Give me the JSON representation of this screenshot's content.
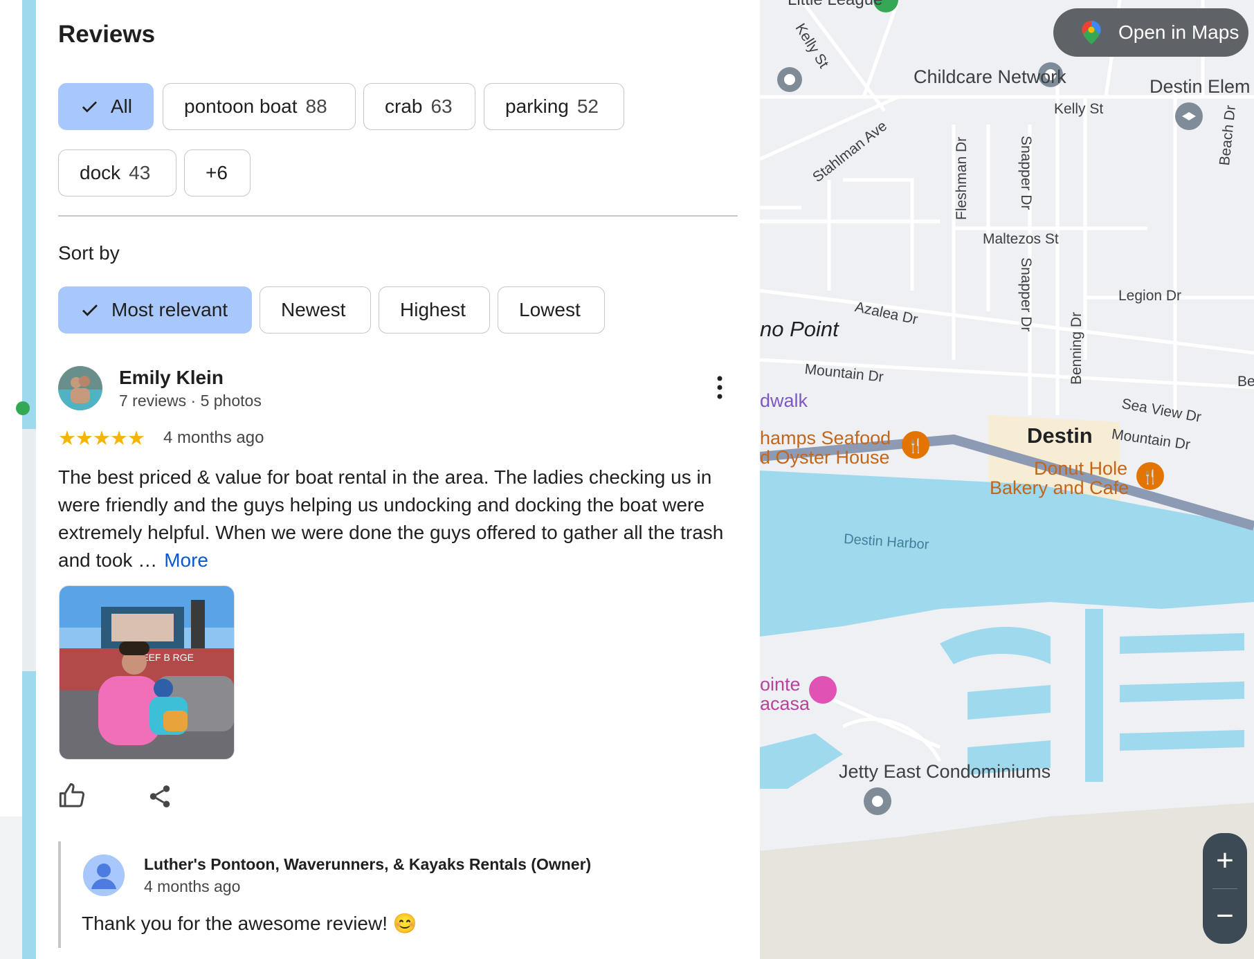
{
  "panel": {
    "title": "Reviews",
    "topic_chips": [
      {
        "label": "All",
        "count": "",
        "selected": true
      },
      {
        "label": "pontoon boat",
        "count": "88",
        "selected": false
      },
      {
        "label": "crab",
        "count": "63",
        "selected": false
      },
      {
        "label": "parking",
        "count": "52",
        "selected": false
      },
      {
        "label": "dock",
        "count": "43",
        "selected": false
      },
      {
        "label": "+6",
        "count": "",
        "selected": false
      }
    ],
    "sort_label": "Sort by",
    "sort_chips": [
      {
        "label": "Most relevant",
        "selected": true
      },
      {
        "label": "Newest",
        "selected": false
      },
      {
        "label": "Highest",
        "selected": false
      },
      {
        "label": "Lowest",
        "selected": false
      }
    ]
  },
  "review": {
    "author": "Emily Klein",
    "meta": "7 reviews · 5 photos",
    "stars": "★★★★★",
    "rating": 5,
    "date": "4 months ago",
    "text": "The best priced & value for boat rental in the area. The ladies checking us in were friendly and the guys helping us undocking and docking the boat were extremely helpful. When we were done the guys offered to gather all the trash and took …",
    "more_label": "More",
    "photo_sign": "BEEF B RGE"
  },
  "owner_reply": {
    "name": "Luther's Pontoon, Waverunners, & Kayaks Rentals (Owner)",
    "date": "4 months ago",
    "text": "Thank you for the awesome review! 😊"
  },
  "map": {
    "open_label": "Open in Maps",
    "zoom_in": "+",
    "zoom_out": "−",
    "labels": {
      "league": "Little League",
      "kelly1": "Kelly St",
      "childcare": "Childcare Network",
      "destin_elem": "Destin Elem",
      "kelly2": "Kelly St",
      "stahlman": "Stahlman Ave",
      "fleshman": "Fleshman Dr",
      "snapper1": "Snapper Dr",
      "beach": "Beach Dr",
      "maltezos": "Maltezos St",
      "snapper2": "Snapper Dr",
      "legion": "Legion Dr",
      "azalea": "Azalea Dr",
      "benning": "Benning Dr",
      "point": "no Point",
      "mountain1": "Mountain Dr",
      "be": "Be",
      "sea_view": "Sea View Dr",
      "boardwalk": "dwalk",
      "destin": "Destin",
      "mountain2": "Mountain Dr",
      "champs1": "hamps Seafood",
      "champs2": "d Oyster House",
      "donut1": "Donut Hole",
      "donut2": "Bakery and Cafe",
      "harbor": "Destin Harbor",
      "pointe1": "ointe",
      "pointe2": "acasa",
      "jetty": "Jetty East Condominiums"
    },
    "colors": {
      "water": "#9fd9ee",
      "land": "#eef0f3",
      "road": "#ffffff",
      "highway": "#8c9bb3",
      "food": "#e37400",
      "beach_pin": "#e052b4"
    }
  }
}
